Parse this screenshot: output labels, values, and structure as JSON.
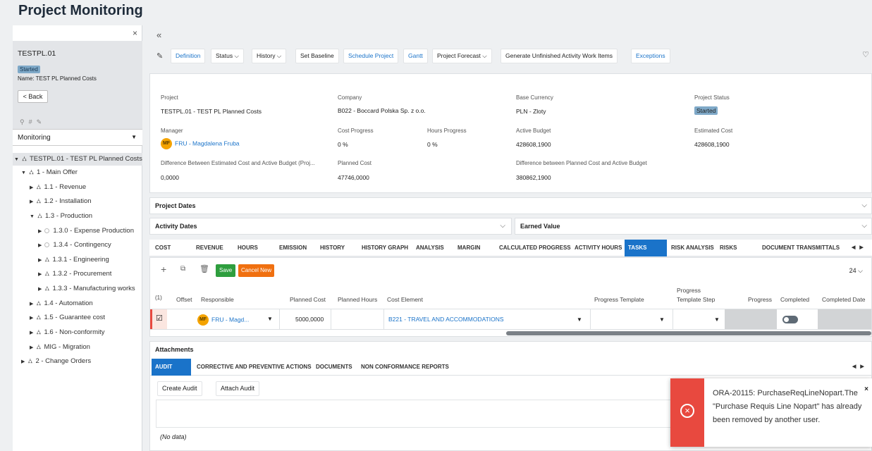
{
  "page_title": "Project Monitoring",
  "sidebar": {
    "close": "×",
    "project_id": "TESTPL.01",
    "status_badge": "Started",
    "name_line": "Name:  TEST PL Planned Costs",
    "back": "< Back",
    "select_value": "Monitoring",
    "tree": [
      {
        "label": "TESTPL.01 - TEST PL Planned Costs"
      },
      {
        "label": "1 - Main Offer"
      },
      {
        "label": "1.1 - Revenue"
      },
      {
        "label": "1.2 - Installation"
      },
      {
        "label": "1.3 - Production"
      },
      {
        "label": "1.3.0 - Expense Production"
      },
      {
        "label": "1.3.4 - Contingency"
      },
      {
        "label": "1.3.1 - Engineering"
      },
      {
        "label": "1.3.2 - Procurement"
      },
      {
        "label": "1.3.3 - Manufacturing works"
      },
      {
        "label": "1.4 - Automation"
      },
      {
        "label": "1.5 - Guarantee cost"
      },
      {
        "label": "1.6 - Non-conformity"
      },
      {
        "label": "MIG - Migration"
      },
      {
        "label": "2 - Change Orders"
      }
    ]
  },
  "toolbar": {
    "collapse": "«",
    "items": [
      "Definition",
      "Status ⌵",
      "History ⌵",
      "Set Baseline",
      "Schedule Project",
      "Gantt",
      "Project Forecast ⌵",
      "Generate Unfinished Activity Work Items",
      "Exceptions"
    ]
  },
  "details": {
    "project_label": "Project",
    "project_value": "TESTPL.01 - TEST PL Planned Costs",
    "company_label": "Company",
    "company_value": "B022 - Boccard Polska Sp. z o.o.",
    "currency_label": "Base Currency",
    "currency_value": "PLN - Zloty",
    "status_label": "Project Status",
    "status_value": "Started",
    "manager_label": "Manager",
    "manager_initials": "MF",
    "manager_value": "FRU - Magdalena Fruba",
    "cost_progress_label": "Cost Progress",
    "cost_progress_value": "0 %",
    "hours_progress_label": "Hours Progress",
    "hours_progress_value": "0 %",
    "active_budget_label": "Active Budget",
    "active_budget_value": "428608,1900",
    "estimated_cost_label": "Estimated Cost",
    "estimated_cost_value": "428608,1900",
    "diff_est_label": "Difference Between Estimated Cost and Active Budget (Proj...",
    "diff_est_value": "0,0000",
    "planned_cost_label": "Planned Cost",
    "planned_cost_value": "47746,0000",
    "diff_planned_label": "Difference between Planned Cost and Active Budget",
    "diff_planned_value": "380862,1900"
  },
  "sections": {
    "project_dates": "Project Dates",
    "activity_dates": "Activity Dates",
    "earned_value": "Earned Value"
  },
  "tabs": [
    "COST",
    "REVENUE",
    "HOURS",
    "EMISSION",
    "HISTORY",
    "HISTORY GRAPH",
    "ANALYSIS",
    "MARGIN",
    "CALCULATED PROGRESS",
    "ACTIVITY HOURS",
    "TASKS",
    "RISK ANALYSIS",
    "RISKS",
    "DOCUMENT TRANSMITTALS"
  ],
  "grid": {
    "save": "Save",
    "cancel_new": "Cancel New",
    "page_size": "24 ⌵",
    "count": "(1)",
    "headers": [
      "Offset",
      "Responsible",
      "Planned Cost",
      "Planned Hours",
      "Cost Element",
      "Progress Template",
      "Progress Template Step",
      "Progress",
      "Completed",
      "Completed Date"
    ],
    "row": {
      "responsible_initials": "MF",
      "responsible": "FRU - Magd...",
      "planned_cost": "5000,0000",
      "cost_element": "B221 - TRAVEL AND ACCOMMODATIONS"
    }
  },
  "attachments": {
    "title": "Attachments",
    "tabs": [
      "AUDIT",
      "CORRECTIVE AND PREVENTIVE ACTIONS",
      "DOCUMENTS",
      "NON CONFORMANCE REPORTS"
    ],
    "create_audit": "Create Audit",
    "attach_audit": "Attach Audit",
    "no_data": "(No data)"
  },
  "error": {
    "message": "ORA-20115: PurchaseReqLineNopart.The \"Purchase Requis Line Nopart\" has already been removed by another user.",
    "close": "×"
  }
}
